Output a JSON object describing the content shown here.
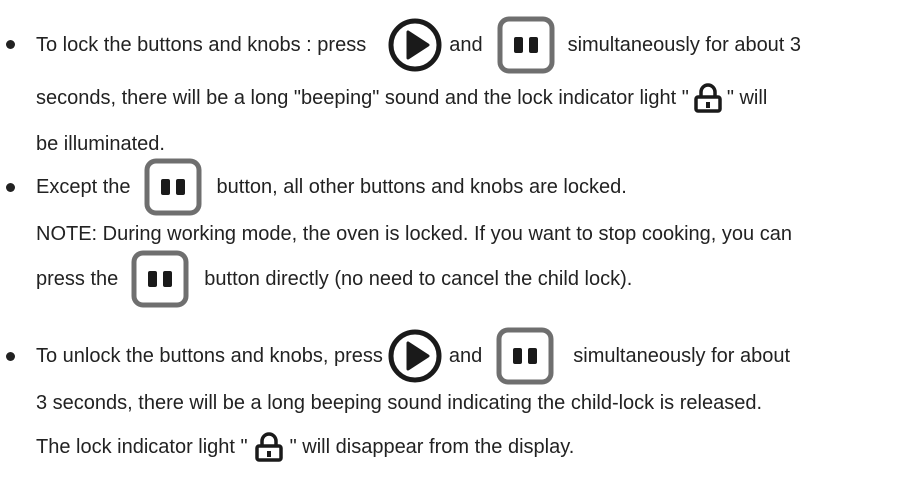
{
  "icons": {
    "play": "play-icon",
    "pause": "pause-icon",
    "lock": "lock-icon"
  },
  "colors": {
    "text": "#222222",
    "play_button": "#1a1a1a",
    "pause_button_border": "#6f6f6f",
    "pause_bars": "#1a1a1a"
  },
  "bullet1": {
    "line1_before": "To lock the buttons and knobs : press",
    "line1_and": "and",
    "line1_after": "simultaneously for about 3",
    "line2_before": "seconds, there will be a long \"beeping\" sound and the lock indicator light \"",
    "line2_after": "\" will",
    "line3": "be illuminated."
  },
  "bullet2": {
    "line1_before": "Except the",
    "line1_after": "button, all other buttons and knobs are locked.",
    "note_line1": "NOTE: During working mode, the oven is locked. If you want to stop cooking, you can",
    "note_line2_before": "press the",
    "note_line2_after": "button directly (no need to cancel the child lock)."
  },
  "bullet3": {
    "line1_before": "To unlock the buttons and knobs, press",
    "line1_and": "and",
    "line1_after": "simultaneously for about",
    "line2": "3 seconds, there will be a long beeping sound indicating the child-lock is released.",
    "line3_before": "The lock indicator light \"",
    "line3_after": "\" will disappear from the display."
  }
}
